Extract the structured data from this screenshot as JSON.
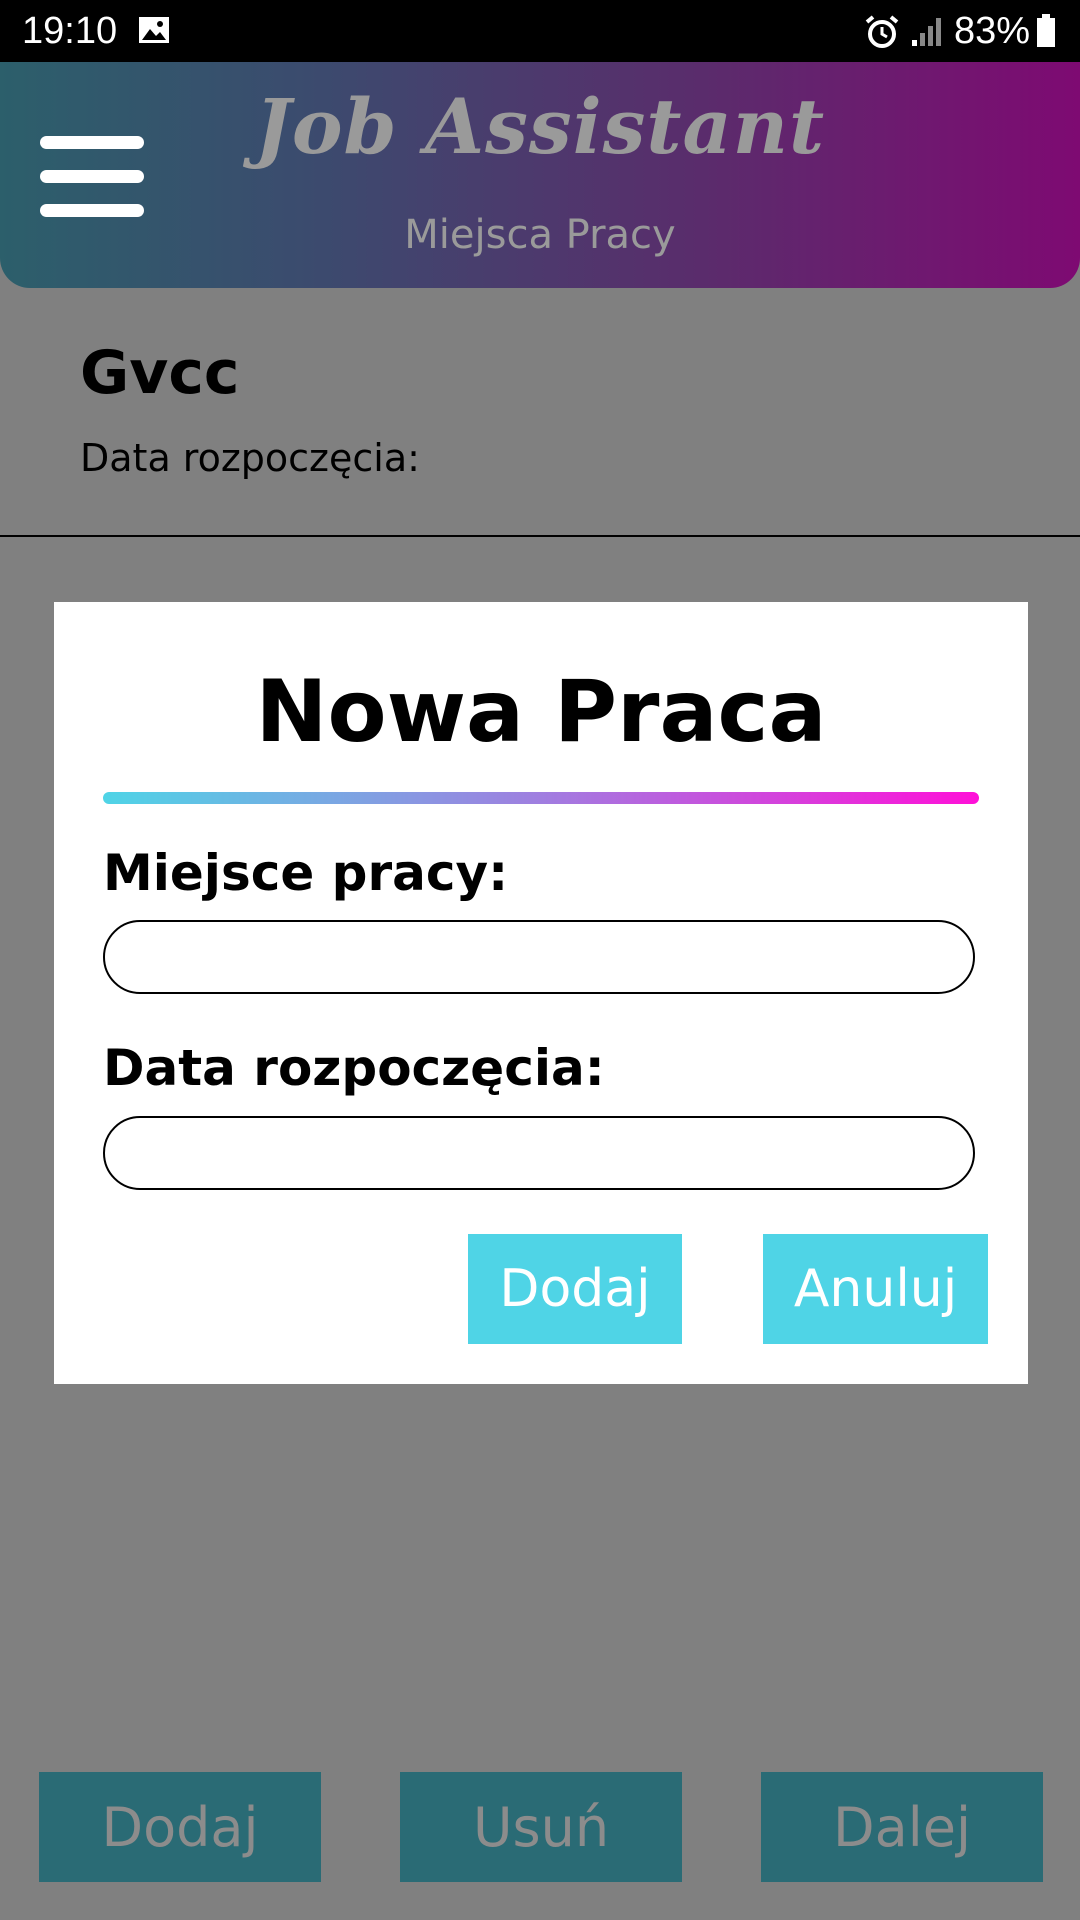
{
  "status_bar": {
    "time": "19:10",
    "battery_percent": "83%",
    "icons": [
      "image-icon",
      "alarm-icon",
      "signal-icon",
      "battery-icon"
    ]
  },
  "header": {
    "title": "Job Assistant",
    "subtitle": "Miejsca Pracy",
    "menu_icon": "hamburger-menu-icon"
  },
  "job_list": [
    {
      "name": "Gvcc",
      "start_date_label": "Data rozpoczęcia:"
    }
  ],
  "dialog": {
    "title": "Nowa Praca",
    "workplace_label": "Miejsce pracy:",
    "workplace_value": "",
    "start_date_label": "Data rozpoczęcia:",
    "start_date_value": "",
    "add_button": "Dodaj",
    "cancel_button": "Anuluj"
  },
  "bottom_bar": {
    "add": "Dodaj",
    "remove": "Usuń",
    "next": "Dalej"
  },
  "colors": {
    "accent": "#4fd4e6",
    "gradient_end": "#ff10d8",
    "bottom_button": "#2a6b75",
    "overlay": "#808080"
  }
}
